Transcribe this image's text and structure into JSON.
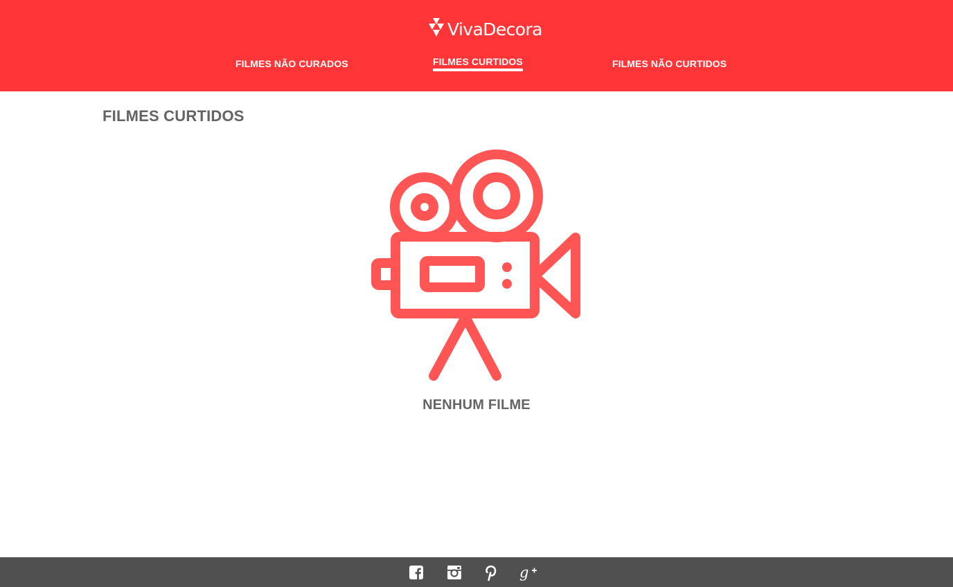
{
  "brand": {
    "name": "VivaDecora",
    "color": "#ff3538"
  },
  "nav": {
    "items": [
      {
        "label": "FILMES NÃO CURADOS",
        "active": false
      },
      {
        "label": "FILMES CURTIDOS",
        "active": true
      },
      {
        "label": "FILMES NÃO CURTIDOS",
        "active": false
      }
    ]
  },
  "main": {
    "title": "FILMES CURTIDOS",
    "empty_icon": "movie-camera-icon",
    "empty_message": "NENHUM FILME",
    "icon_color": "#ff5555"
  },
  "footer": {
    "background": "#505050",
    "social": [
      {
        "name": "facebook-icon"
      },
      {
        "name": "instagram-icon"
      },
      {
        "name": "pinterest-icon"
      },
      {
        "name": "google-plus-icon"
      }
    ]
  }
}
